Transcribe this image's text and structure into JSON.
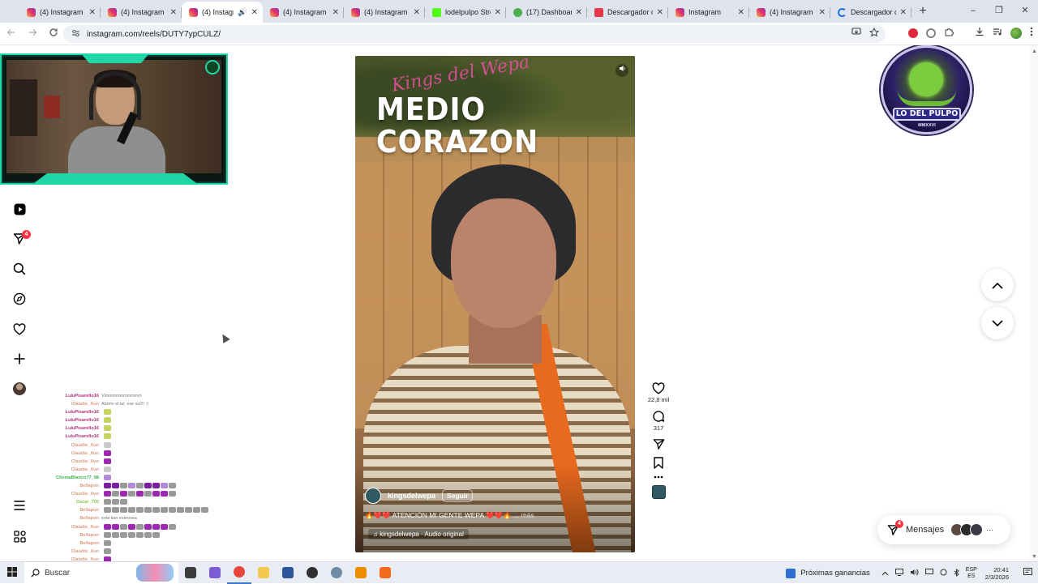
{
  "browser": {
    "tabs": [
      {
        "title": "(4) Instagram",
        "favicon": "instagram-icon",
        "active": false
      },
      {
        "title": "(4) Instagram",
        "favicon": "instagram-icon",
        "active": false
      },
      {
        "title": "(4) Instagram",
        "favicon": "instagram-icon",
        "active": true,
        "audio": true
      },
      {
        "title": "(4) Instagram",
        "favicon": "instagram-icon",
        "active": false
      },
      {
        "title": "(4) Instagram",
        "favicon": "instagram-icon",
        "active": false
      },
      {
        "title": "lodelpulpo Stre",
        "favicon": "kick-icon",
        "active": false
      },
      {
        "title": "(17) Dashboard",
        "favicon": "dashboard-icon",
        "active": false
      },
      {
        "title": "Descargador de",
        "favicon": "downloader-icon",
        "active": false
      },
      {
        "title": "Instagram",
        "favicon": "instagram-icon",
        "active": false
      },
      {
        "title": "(4) Instagram",
        "favicon": "instagram-icon",
        "active": false
      },
      {
        "title": "Descargador de",
        "favicon": "loading-icon",
        "active": false
      }
    ],
    "new_tab": "+",
    "url": "instagram.com/reels/DUTY7ypCULZ/",
    "window_controls": {
      "minimize": "–",
      "maximize": "❐",
      "close": "✕"
    }
  },
  "overlay": {
    "chat": [
      {
        "user": "LuluPisarello16",
        "color": "#b0317f",
        "msg": "Vimmmmmmmmmm",
        "emotes": []
      },
      {
        "user": "Claudio_Xun",
        "color": "#d89a7d",
        "msg": "Abrelo el tal, ese xul!!! :)",
        "emotes": []
      },
      {
        "user": "LuluPisarello16",
        "color": "#b0317f",
        "msg": "",
        "emotes": [
          "#c7d35f"
        ]
      },
      {
        "user": "LuluPisarello16",
        "color": "#b0317f",
        "msg": "",
        "emotes": [
          "#c7d35f"
        ]
      },
      {
        "user": "LuluPisarello16",
        "color": "#b0317f",
        "msg": "",
        "emotes": [
          "#c7d35f"
        ]
      },
      {
        "user": "LuluPisarello16",
        "color": "#b0317f",
        "msg": "",
        "emotes": [
          "#c7d35f"
        ]
      },
      {
        "user": "Claudio_Xun",
        "color": "#d89a7d",
        "msg": "",
        "emotes": [
          "#c9c9c9"
        ]
      },
      {
        "user": "Claudio_Xun",
        "color": "#d89a7d",
        "msg": "",
        "emotes": [
          "#9c27b0"
        ]
      },
      {
        "user": "Claudio_Xun",
        "color": "#d89a7d",
        "msg": "",
        "emotes": [
          "#9c27b0"
        ]
      },
      {
        "user": "Claudio_Xun",
        "color": "#d89a7d",
        "msg": "",
        "emotes": [
          "#c9c9c9"
        ]
      },
      {
        "user": "ChemaBlanco77_98",
        "color": "#3bb54a",
        "msg": "",
        "emotes": [
          "#b38bd8"
        ]
      },
      {
        "user": "Bellapon",
        "color": "#d89a7d",
        "msg": "",
        "emotes": [
          "#7b1fa2",
          "#7b1fa2",
          "#999",
          "#b38bd8",
          "#999",
          "#7b1fa2",
          "#7b1fa2",
          "#b38bd8",
          "#999"
        ]
      },
      {
        "user": "Claudio_Xun",
        "color": "#d89a7d",
        "msg": "",
        "emotes": [
          "#9c27b0",
          "#999",
          "#9c27b0",
          "#999",
          "#9c27b0",
          "#999",
          "#9c27b0",
          "#9c27b0",
          "#999"
        ]
      },
      {
        "user": "Oscar_705",
        "color": "#8bc34a",
        "msg": "",
        "emotes": [
          "#999",
          "#999",
          "#999"
        ]
      },
      {
        "user": "Bellapon",
        "color": "#d89a7d",
        "msg": "",
        "emotes": [
          "#999",
          "#999",
          "#999",
          "#999",
          "#999",
          "#999",
          "#999",
          "#999",
          "#999",
          "#999",
          "#999",
          "#999",
          "#999"
        ]
      },
      {
        "user": "Bellapon",
        "color": "#d89a7d",
        "msg": "esta kan esteosea",
        "emotes": []
      },
      {
        "user": "Claudio_Xun",
        "color": "#d89a7d",
        "msg": "",
        "emotes": [
          "#9c27b0",
          "#9c27b0",
          "#999",
          "#9c27b0",
          "#999",
          "#9c27b0",
          "#9c27b0",
          "#9c27b0",
          "#999"
        ]
      },
      {
        "user": "Bellapon",
        "color": "#d89a7d",
        "msg": "",
        "emotes": [
          "#999",
          "#999",
          "#999",
          "#999",
          "#999",
          "#999",
          "#999"
        ]
      },
      {
        "user": "Bellapon",
        "color": "#d89a7d",
        "msg": "",
        "emotes": [
          "#999"
        ]
      },
      {
        "user": "Claudio_Xun",
        "color": "#d89a7d",
        "msg": "",
        "emotes": [
          "#999"
        ]
      },
      {
        "user": "Claudio_Xun",
        "color": "#d89a7d",
        "msg": "",
        "emotes": [
          "#9c27b0"
        ]
      }
    ],
    "channel_logo": {
      "title": "LO DEL PULPO",
      "subtitle": "MMXXVI"
    }
  },
  "sidebar": {
    "notifications_count": "4",
    "items": [
      {
        "name": "reels",
        "icon": "reels-icon"
      },
      {
        "name": "messages",
        "icon": "direct-icon"
      },
      {
        "name": "search",
        "icon": "search-icon"
      },
      {
        "name": "explore",
        "icon": "compass-icon"
      },
      {
        "name": "notifications",
        "icon": "heart-icon"
      },
      {
        "name": "create",
        "icon": "plus-icon"
      },
      {
        "name": "profile",
        "icon": "avatar"
      },
      {
        "name": "more",
        "icon": "menu-icon"
      },
      {
        "name": "also-from-meta",
        "icon": "meta-apps-icon"
      }
    ]
  },
  "reel": {
    "overlay_script": "Kings del Wepa",
    "overlay_title_line1": "MEDIO",
    "overlay_title_line2": "CORAZON",
    "author": "kingsdelwepa",
    "follow_label": "Seguir",
    "caption": "🔥❤️❤️ ATENCIÓN MI GENTE WEPA ❤️❤️🔥 ... ",
    "caption_more": "más",
    "audio": "kingsdelwepa · Audio original",
    "likes": "22,8 mil",
    "comments": "317"
  },
  "messages_widget": {
    "label": "Mensajes",
    "badge": "4"
  },
  "taskbar": {
    "search_placeholder": "Buscar",
    "news": "Próximas ganancias",
    "lang_top": "ESP",
    "lang_bottom": "ES",
    "time": "20:41",
    "date": "2/3/2026",
    "apps": [
      {
        "name": "task-view",
        "color": "#3c3c3c"
      },
      {
        "name": "copilot",
        "color": "#7b5cd6"
      },
      {
        "name": "chrome",
        "color": "#e8453c"
      },
      {
        "name": "file-explorer",
        "color": "#f2c94c"
      },
      {
        "name": "word",
        "color": "#2b579a"
      },
      {
        "name": "obs",
        "color": "#302e31"
      },
      {
        "name": "app-steam",
        "color": "#6e8aa6"
      },
      {
        "name": "vlc",
        "color": "#f08c00"
      },
      {
        "name": "app-orange",
        "color": "#f26b1d"
      }
    ]
  }
}
